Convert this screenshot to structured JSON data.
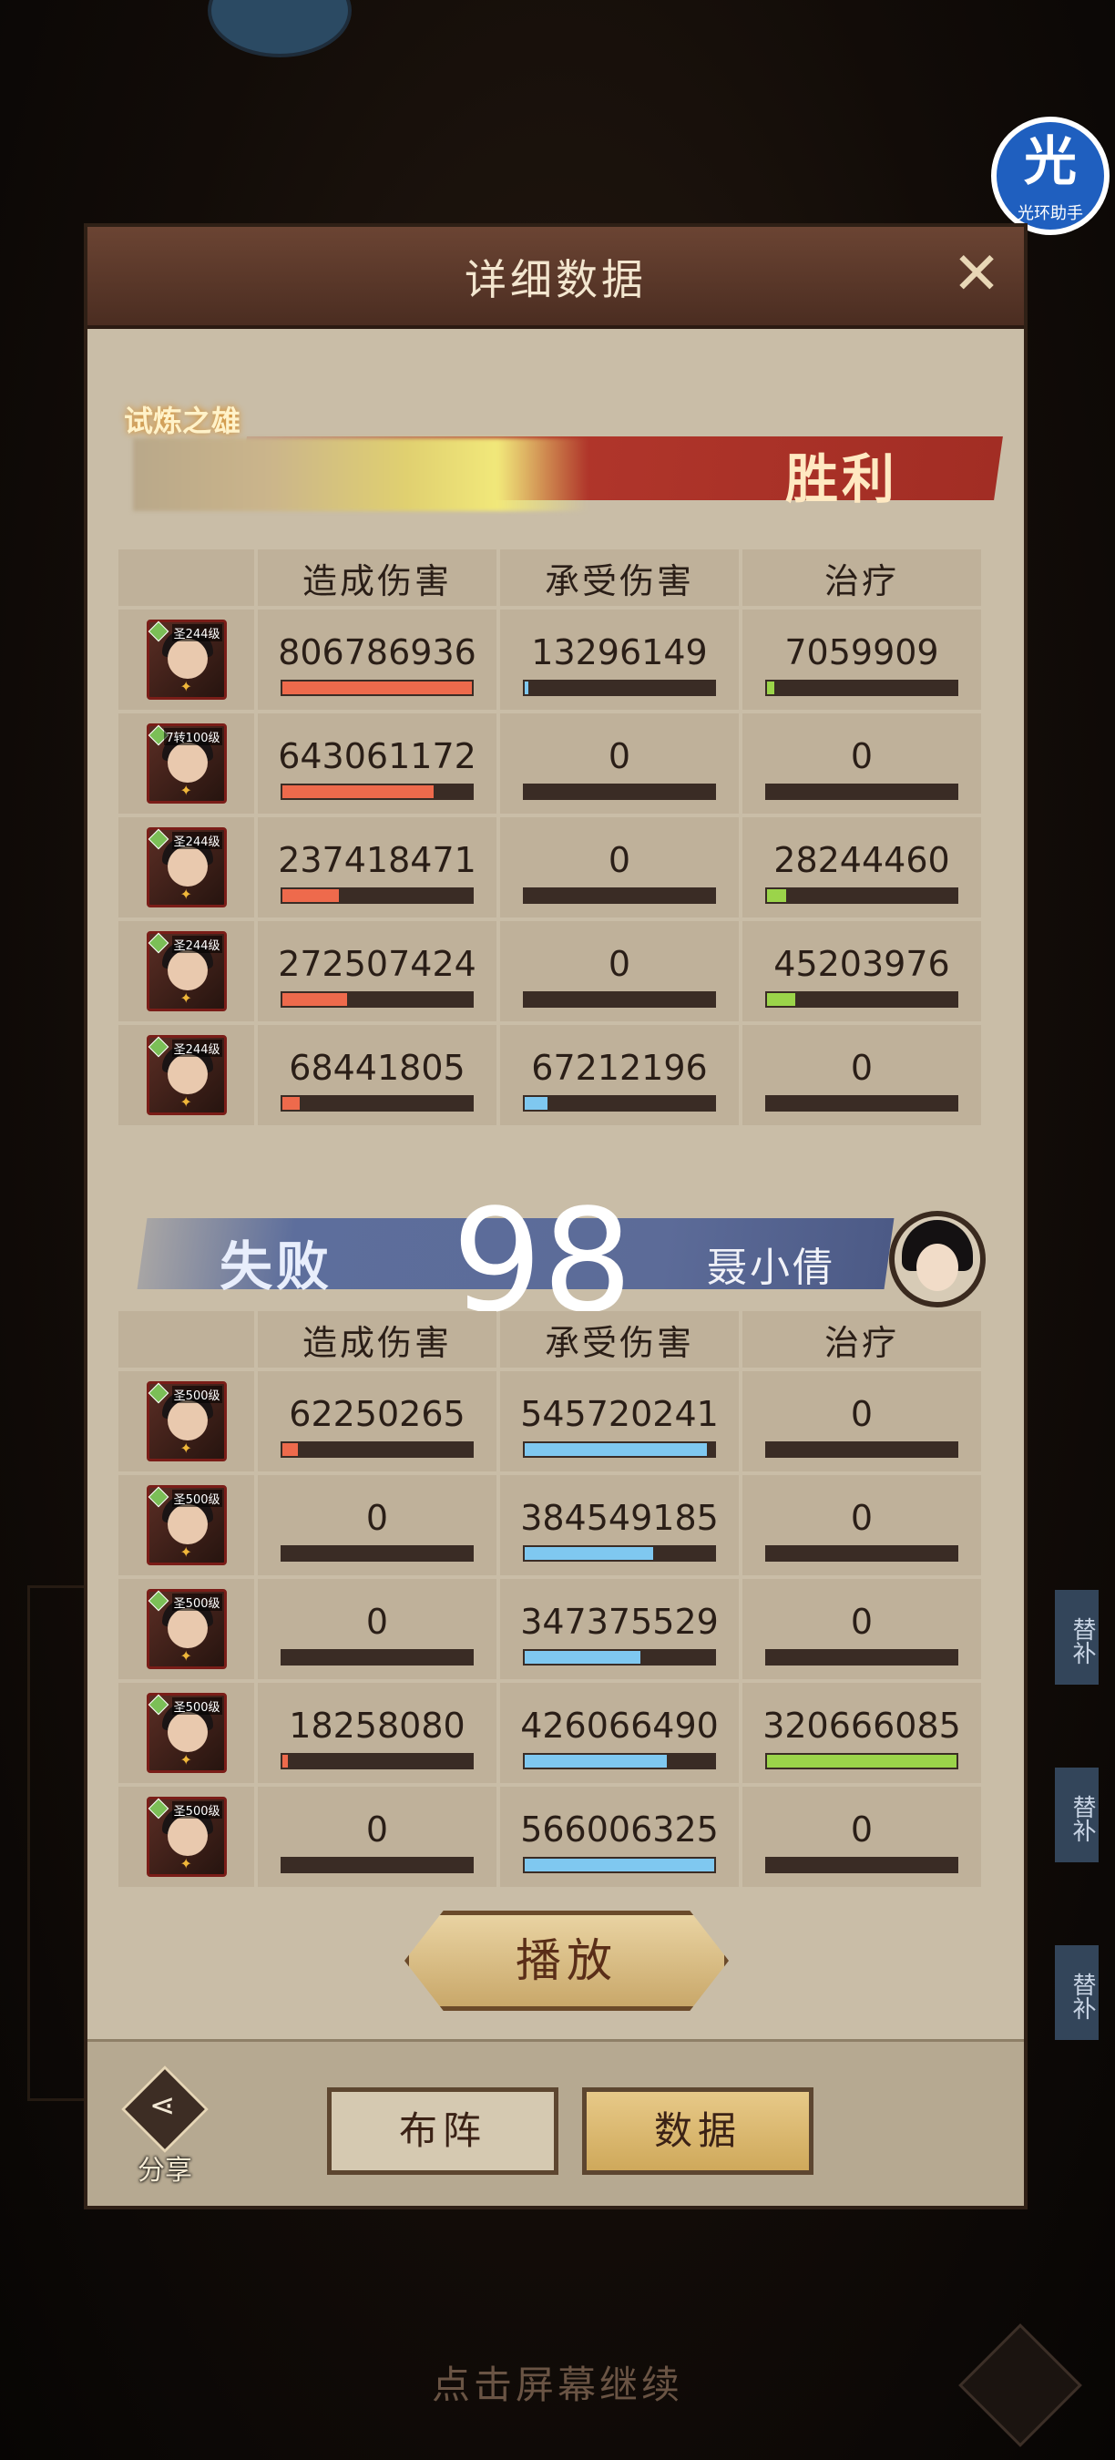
{
  "dialog": {
    "title": "详细数据",
    "close_glyph": "✕"
  },
  "helper": {
    "glyph": "光",
    "label": "光环助手"
  },
  "winner": {
    "title_tag": "试炼之雄",
    "result": "胜利",
    "headers": [
      "造成伤害",
      "承受伤害",
      "治疗"
    ],
    "rows": [
      {
        "level": "圣244级",
        "dealt": "806786936",
        "taken": "13296149",
        "heal": "7059909",
        "dealt_ratio": 1.0,
        "taken_ratio": 0.02,
        "heal_ratio": 0.04
      },
      {
        "level": "7转100级",
        "dealt": "643061172",
        "taken": "0",
        "heal": "0",
        "dealt_ratio": 0.8,
        "taken_ratio": 0,
        "heal_ratio": 0
      },
      {
        "level": "圣244级",
        "dealt": "237418471",
        "taken": "0",
        "heal": "28244460",
        "dealt_ratio": 0.3,
        "taken_ratio": 0,
        "heal_ratio": 0.1
      },
      {
        "level": "圣244级",
        "dealt": "272507424",
        "taken": "0",
        "heal": "45203976",
        "dealt_ratio": 0.34,
        "taken_ratio": 0,
        "heal_ratio": 0.15
      },
      {
        "level": "圣244级",
        "dealt": "68441805",
        "taken": "67212196",
        "heal": "0",
        "dealt_ratio": 0.09,
        "taken_ratio": 0.12,
        "heal_ratio": 0
      }
    ]
  },
  "round_number": "98",
  "loser": {
    "result": "失败",
    "name": "聂小倩",
    "headers": [
      "造成伤害",
      "承受伤害",
      "治疗"
    ],
    "rows": [
      {
        "level": "圣500级",
        "dealt": "62250265",
        "taken": "545720241",
        "heal": "0",
        "dealt_ratio": 0.08,
        "taken_ratio": 0.96,
        "heal_ratio": 0
      },
      {
        "level": "圣500级",
        "dealt": "0",
        "taken": "384549185",
        "heal": "0",
        "dealt_ratio": 0,
        "taken_ratio": 0.68,
        "heal_ratio": 0
      },
      {
        "level": "圣500级",
        "dealt": "0",
        "taken": "347375529",
        "heal": "0",
        "dealt_ratio": 0,
        "taken_ratio": 0.61,
        "heal_ratio": 0
      },
      {
        "level": "圣500级",
        "dealt": "18258080",
        "taken": "426066490",
        "heal": "320666085",
        "dealt_ratio": 0.03,
        "taken_ratio": 0.75,
        "heal_ratio": 1.0
      },
      {
        "level": "圣500级",
        "dealt": "0",
        "taken": "566006325",
        "heal": "0",
        "dealt_ratio": 0,
        "taken_ratio": 1.0,
        "heal_ratio": 0
      }
    ]
  },
  "buttons": {
    "play": "播放",
    "share": "分享",
    "formation": "布阵",
    "data": "数据"
  },
  "side_tags": [
    "替补",
    "替补",
    "替补"
  ],
  "continue_hint": "点击屏幕继续",
  "colors": {
    "damage_bar": "#ee6a4c",
    "taken_bar": "#7fc8f0",
    "heal_bar": "#9bd44a",
    "victory_red": "#b1362b",
    "defeat_blue": "#5d6e9c"
  }
}
